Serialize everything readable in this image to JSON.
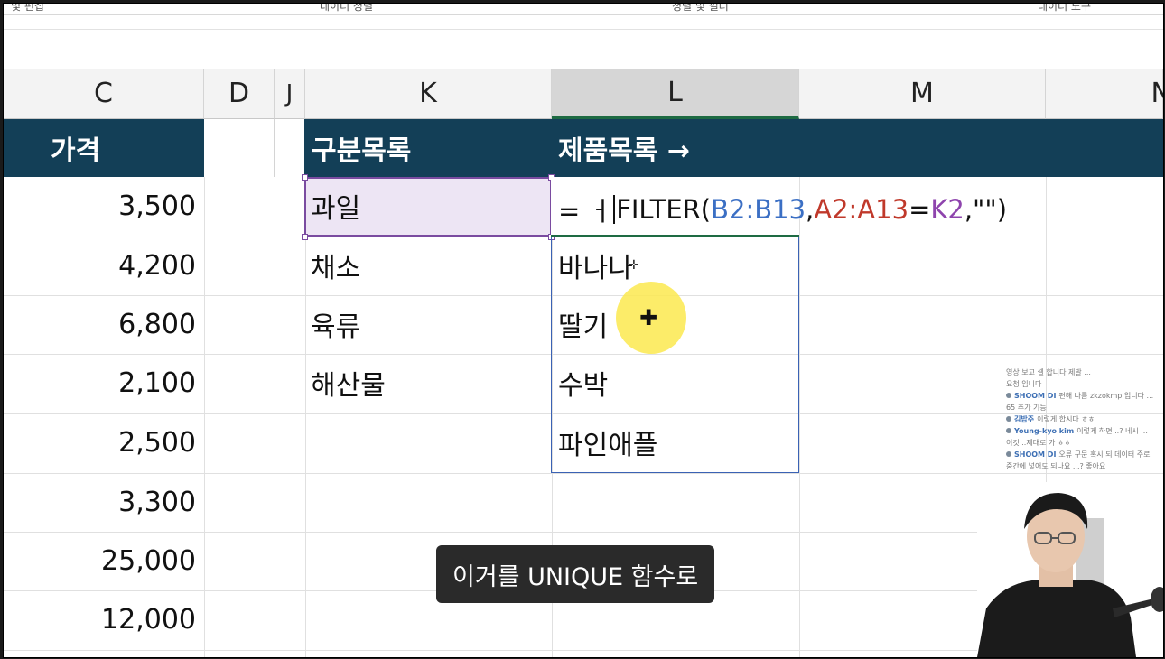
{
  "ribbon": {
    "tabs": [
      "및 편집",
      "데이터 정렬",
      "정렬 및 필터",
      "데이터 도구"
    ]
  },
  "columns": [
    "C",
    "D",
    "J",
    "K",
    "L",
    "M",
    "N"
  ],
  "header_row": {
    "price": "가격",
    "category_list": "구분목록",
    "product_list": "제품목록 →"
  },
  "prices": [
    "3,500",
    "4,200",
    "6,800",
    "2,100",
    "2,500",
    "3,300",
    "25,000",
    "12,000"
  ],
  "categories": [
    "과일",
    "채소",
    "육류",
    "해산물"
  ],
  "formula": {
    "prefix": "= ㅓ",
    "fn": "FILTER(",
    "arg1": "B2:B13",
    "comma1": ",",
    "arg2": "A2:A13",
    "eq": "=",
    "arg3": "K2",
    "tail": ",\"\")"
  },
  "formula_colors": {
    "arg1": "#3b6fc4",
    "arg2": "#c0392b",
    "arg3": "#8e44ad"
  },
  "products": [
    "바나나",
    "딸기",
    "수박",
    "파인애플"
  ],
  "subtitle": "이거를 UNIQUE 함수로",
  "chat": [
    {
      "name": "",
      "text": "영상 보고 셀 합니다 제발 ..."
    },
    {
      "name": "",
      "text": "요청 입니다"
    },
    {
      "name": "SHOOM DI",
      "text": "편해 나름 zkzokmp 입니다 ..."
    },
    {
      "name": "",
      "text": "65 추가 기능"
    },
    {
      "name": "김밥주",
      "text": "이렇게 합시다 ㅎㅎ"
    },
    {
      "name": "Young-kyo kim",
      "text": "이렇게 하면 ..? 네시 ..."
    },
    {
      "name": "",
      "text": "이것 ..제대로 가 ㅎㅎ"
    },
    {
      "name": "SHOOM DI",
      "text": "오류 구문 혹시 되 데이터 주로"
    },
    {
      "name": "",
      "text": "중간에 넣어도 되나요 ...? 좋아요"
    }
  ],
  "colors": {
    "header_band": "#133f57",
    "selection_purple": "#7a4ba0",
    "spill_blue": "#3a62b4",
    "active_green": "#1e6b43",
    "highlight_yellow": "#fbe94f"
  }
}
